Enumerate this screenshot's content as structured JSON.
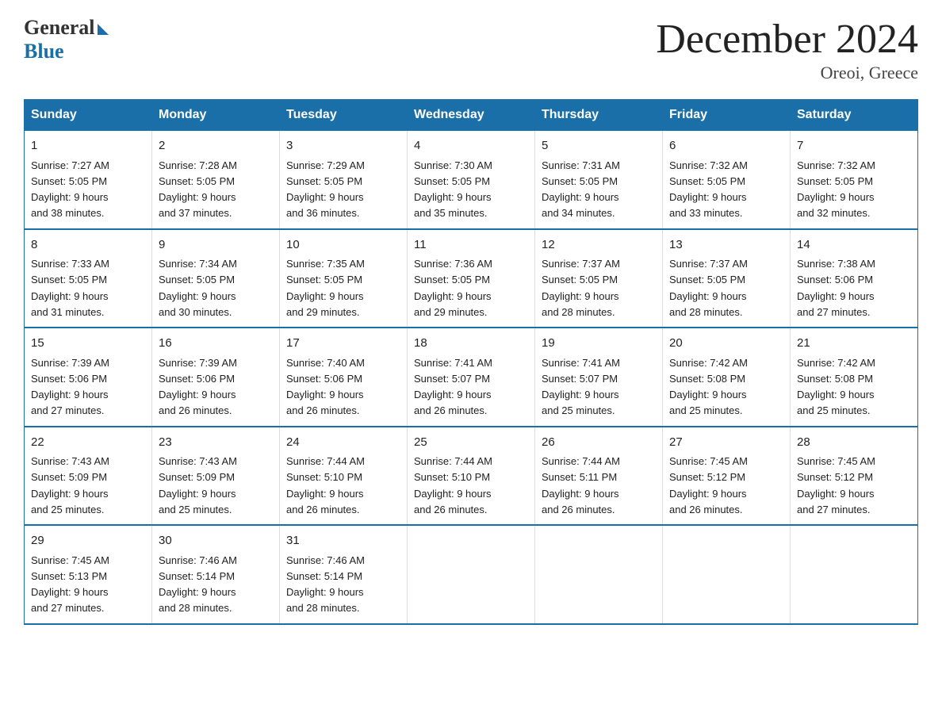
{
  "logo": {
    "general": "General",
    "blue": "Blue"
  },
  "title": "December 2024",
  "location": "Oreoi, Greece",
  "days_of_week": [
    "Sunday",
    "Monday",
    "Tuesday",
    "Wednesday",
    "Thursday",
    "Friday",
    "Saturday"
  ],
  "weeks": [
    [
      {
        "day": "1",
        "sunrise": "7:27 AM",
        "sunset": "5:05 PM",
        "daylight": "9 hours and 38 minutes."
      },
      {
        "day": "2",
        "sunrise": "7:28 AM",
        "sunset": "5:05 PM",
        "daylight": "9 hours and 37 minutes."
      },
      {
        "day": "3",
        "sunrise": "7:29 AM",
        "sunset": "5:05 PM",
        "daylight": "9 hours and 36 minutes."
      },
      {
        "day": "4",
        "sunrise": "7:30 AM",
        "sunset": "5:05 PM",
        "daylight": "9 hours and 35 minutes."
      },
      {
        "day": "5",
        "sunrise": "7:31 AM",
        "sunset": "5:05 PM",
        "daylight": "9 hours and 34 minutes."
      },
      {
        "day": "6",
        "sunrise": "7:32 AM",
        "sunset": "5:05 PM",
        "daylight": "9 hours and 33 minutes."
      },
      {
        "day": "7",
        "sunrise": "7:32 AM",
        "sunset": "5:05 PM",
        "daylight": "9 hours and 32 minutes."
      }
    ],
    [
      {
        "day": "8",
        "sunrise": "7:33 AM",
        "sunset": "5:05 PM",
        "daylight": "9 hours and 31 minutes."
      },
      {
        "day": "9",
        "sunrise": "7:34 AM",
        "sunset": "5:05 PM",
        "daylight": "9 hours and 30 minutes."
      },
      {
        "day": "10",
        "sunrise": "7:35 AM",
        "sunset": "5:05 PM",
        "daylight": "9 hours and 29 minutes."
      },
      {
        "day": "11",
        "sunrise": "7:36 AM",
        "sunset": "5:05 PM",
        "daylight": "9 hours and 29 minutes."
      },
      {
        "day": "12",
        "sunrise": "7:37 AM",
        "sunset": "5:05 PM",
        "daylight": "9 hours and 28 minutes."
      },
      {
        "day": "13",
        "sunrise": "7:37 AM",
        "sunset": "5:05 PM",
        "daylight": "9 hours and 28 minutes."
      },
      {
        "day": "14",
        "sunrise": "7:38 AM",
        "sunset": "5:06 PM",
        "daylight": "9 hours and 27 minutes."
      }
    ],
    [
      {
        "day": "15",
        "sunrise": "7:39 AM",
        "sunset": "5:06 PM",
        "daylight": "9 hours and 27 minutes."
      },
      {
        "day": "16",
        "sunrise": "7:39 AM",
        "sunset": "5:06 PM",
        "daylight": "9 hours and 26 minutes."
      },
      {
        "day": "17",
        "sunrise": "7:40 AM",
        "sunset": "5:06 PM",
        "daylight": "9 hours and 26 minutes."
      },
      {
        "day": "18",
        "sunrise": "7:41 AM",
        "sunset": "5:07 PM",
        "daylight": "9 hours and 26 minutes."
      },
      {
        "day": "19",
        "sunrise": "7:41 AM",
        "sunset": "5:07 PM",
        "daylight": "9 hours and 25 minutes."
      },
      {
        "day": "20",
        "sunrise": "7:42 AM",
        "sunset": "5:08 PM",
        "daylight": "9 hours and 25 minutes."
      },
      {
        "day": "21",
        "sunrise": "7:42 AM",
        "sunset": "5:08 PM",
        "daylight": "9 hours and 25 minutes."
      }
    ],
    [
      {
        "day": "22",
        "sunrise": "7:43 AM",
        "sunset": "5:09 PM",
        "daylight": "9 hours and 25 minutes."
      },
      {
        "day": "23",
        "sunrise": "7:43 AM",
        "sunset": "5:09 PM",
        "daylight": "9 hours and 25 minutes."
      },
      {
        "day": "24",
        "sunrise": "7:44 AM",
        "sunset": "5:10 PM",
        "daylight": "9 hours and 26 minutes."
      },
      {
        "day": "25",
        "sunrise": "7:44 AM",
        "sunset": "5:10 PM",
        "daylight": "9 hours and 26 minutes."
      },
      {
        "day": "26",
        "sunrise": "7:44 AM",
        "sunset": "5:11 PM",
        "daylight": "9 hours and 26 minutes."
      },
      {
        "day": "27",
        "sunrise": "7:45 AM",
        "sunset": "5:12 PM",
        "daylight": "9 hours and 26 minutes."
      },
      {
        "day": "28",
        "sunrise": "7:45 AM",
        "sunset": "5:12 PM",
        "daylight": "9 hours and 27 minutes."
      }
    ],
    [
      {
        "day": "29",
        "sunrise": "7:45 AM",
        "sunset": "5:13 PM",
        "daylight": "9 hours and 27 minutes."
      },
      {
        "day": "30",
        "sunrise": "7:46 AM",
        "sunset": "5:14 PM",
        "daylight": "9 hours and 28 minutes."
      },
      {
        "day": "31",
        "sunrise": "7:46 AM",
        "sunset": "5:14 PM",
        "daylight": "9 hours and 28 minutes."
      },
      null,
      null,
      null,
      null
    ]
  ],
  "labels": {
    "sunrise": "Sunrise:",
    "sunset": "Sunset:",
    "daylight": "Daylight:"
  },
  "colors": {
    "header_bg": "#1a6fa8",
    "header_text": "#ffffff",
    "border": "#1a6fa8"
  }
}
